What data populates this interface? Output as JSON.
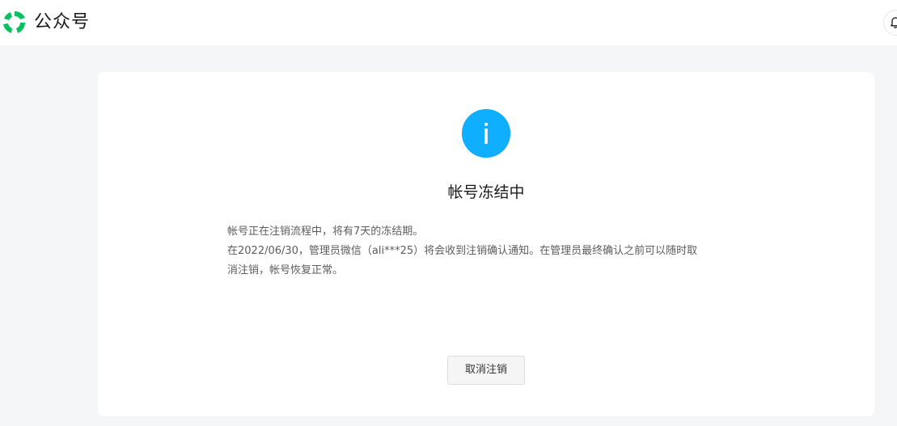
{
  "header": {
    "brand_name": "公众号",
    "logo_icon": "wechat-official-account-logo-icon",
    "notification_icon": "bell-icon",
    "brand_color": "#07c160"
  },
  "notice": {
    "status_icon": "info-icon",
    "status_icon_color": "#10aeff",
    "title": "帐号冻结中",
    "line1": "帐号正在注销流程中，将有7天的冻结期。",
    "line2": "在2022/06/30，管理员微信（ali***25）将会收到注销确认通知。在管理员最终确认之前可以随时取",
    "line3": "消注销，帐号恢复正常。"
  },
  "actions": {
    "cancel_label": "取消注销"
  }
}
